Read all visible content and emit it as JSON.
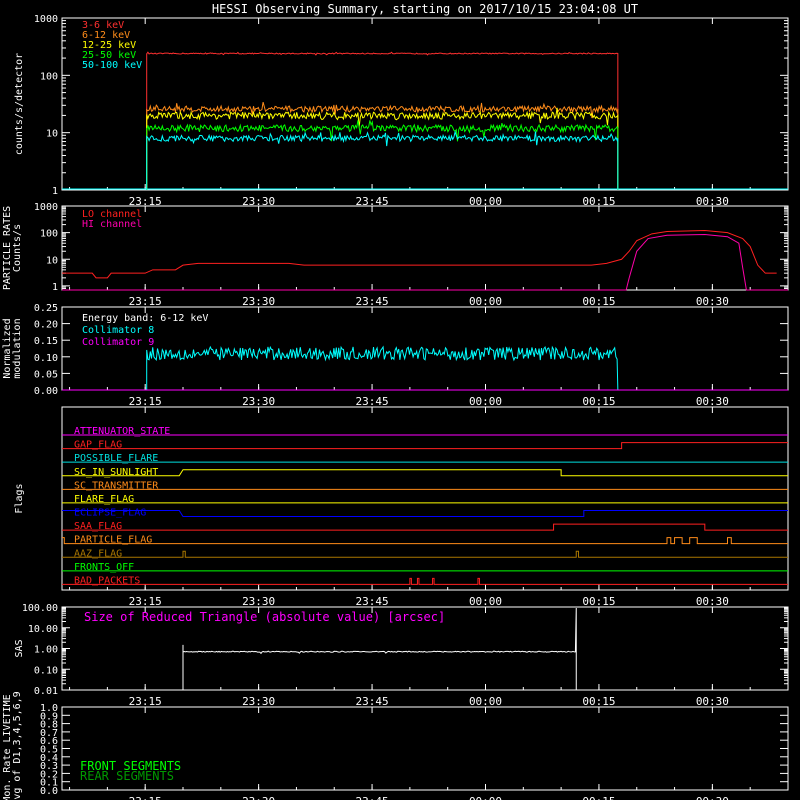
{
  "page": {
    "title": "HESSI Observing Summary, starting on 2017/10/15 23:04:08 UT"
  },
  "time_axis": {
    "tick_labels": [
      "23:15",
      "23:30",
      "23:45",
      "00:00",
      "00:15",
      "00:30"
    ],
    "tick_minutes": [
      11,
      26,
      41,
      56,
      71,
      86
    ],
    "minute_labels": [
      "23:15",
      "23:30",
      "23:45",
      "00:00",
      "00:15",
      "00:30"
    ],
    "range_minutes": [
      0,
      96
    ]
  },
  "chart_data": [
    {
      "name": "count-rates",
      "type": "line",
      "ylabel": "counts/s/detector",
      "yscale": "log",
      "ylim": [
        1,
        1000
      ],
      "yticks": [
        {
          "v": 1,
          "label": "1"
        },
        {
          "v": 10,
          "label": "10"
        },
        {
          "v": 100,
          "label": "100"
        },
        {
          "v": 1000,
          "label": "1000"
        }
      ],
      "legend_position": "top-left",
      "series": [
        {
          "name": "3-6 keV",
          "color": "#ff3030",
          "segments": [
            {
              "start": 11.2,
              "end": 73.5,
              "level": 240,
              "noise": 0.02
            }
          ]
        },
        {
          "name": "6-12 keV",
          "color": "#ff8c1a",
          "segments": [
            {
              "start": 11.2,
              "end": 73.5,
              "level": 26,
              "noise": 0.12
            }
          ]
        },
        {
          "name": "12-25 keV",
          "color": "#ffff00",
          "segments": [
            {
              "start": 11.2,
              "end": 73.5,
              "level": 20,
              "noise": 0.14
            }
          ]
        },
        {
          "name": "25-50 keV",
          "color": "#00ff00",
          "segments": [
            {
              "start": 11.2,
              "end": 73.5,
              "level": 12,
              "noise": 0.14
            }
          ]
        },
        {
          "name": "50-100 keV",
          "color": "#00ffff",
          "segments": [
            {
              "start": 11.2,
              "end": 73.5,
              "level": 8,
              "noise": 0.12
            }
          ]
        }
      ]
    },
    {
      "name": "particle-rates",
      "type": "line",
      "ylabel": [
        "PARTICLE RATES",
        "Counts/s"
      ],
      "yscale": "log",
      "ylim": [
        0.7,
        1000
      ],
      "yticks": [
        {
          "v": 1,
          "label": "1"
        },
        {
          "v": 10,
          "label": "10"
        },
        {
          "v": 100,
          "label": "100"
        },
        {
          "v": 1000,
          "label": "1000"
        }
      ],
      "legend_position": "top-left",
      "series": [
        {
          "name": "LO channel",
          "color": "#ff2020",
          "points": [
            [
              0,
              3
            ],
            [
              4,
              3
            ],
            [
              4.5,
              2
            ],
            [
              6,
              2
            ],
            [
              6.5,
              3
            ],
            [
              11,
              3
            ],
            [
              12,
              4
            ],
            [
              15,
              4
            ],
            [
              16,
              6
            ],
            [
              18,
              7
            ],
            [
              30,
              7
            ],
            [
              32,
              6
            ],
            [
              50,
              6
            ],
            [
              60,
              6
            ],
            [
              70,
              6
            ],
            [
              72,
              7
            ],
            [
              74,
              10
            ],
            [
              75,
              20
            ],
            [
              76,
              50
            ],
            [
              78,
              90
            ],
            [
              80,
              110
            ],
            [
              85,
              120
            ],
            [
              88,
              100
            ],
            [
              90,
              60
            ],
            [
              91,
              30
            ],
            [
              92,
              6
            ],
            [
              93,
              3
            ],
            [
              94.5,
              3
            ]
          ]
        },
        {
          "name": "HI channel",
          "color": "#ff00aa",
          "points": [
            [
              0,
              0.7
            ],
            [
              73.5,
              0.7
            ],
            [
              74.6,
              0.7
            ],
            [
              75,
              2
            ],
            [
              76,
              20
            ],
            [
              77.5,
              60
            ],
            [
              80,
              80
            ],
            [
              85,
              85
            ],
            [
              88,
              70
            ],
            [
              89.5,
              40
            ],
            [
              90,
              5
            ],
            [
              90.5,
              0.7
            ],
            [
              96,
              0.7
            ]
          ]
        }
      ]
    },
    {
      "name": "modulation",
      "type": "line",
      "ylabel": [
        "Normalized",
        "modulation"
      ],
      "ylim": [
        0,
        0.25
      ],
      "yticks": [
        {
          "v": 0,
          "label": "0.00"
        },
        {
          "v": 0.05,
          "label": "0.05"
        },
        {
          "v": 0.1,
          "label": "0.10"
        },
        {
          "v": 0.15,
          "label": "0.15"
        },
        {
          "v": 0.2,
          "label": "0.20"
        },
        {
          "v": 0.25,
          "label": "0.25"
        }
      ],
      "annotation": "Energy band: 6-12 keV",
      "legend_position": "top-left",
      "series": [
        {
          "name": "Collimator 8",
          "color": "#00ffff",
          "segments": [
            {
              "start": 11.2,
              "end": 73.5,
              "level": 0.11,
              "noise": 0.02
            }
          ]
        },
        {
          "name": "Collimator 9",
          "color": "#ff00ff",
          "points": [
            [
              0,
              0
            ],
            [
              96,
              0
            ]
          ]
        }
      ]
    },
    {
      "name": "flags",
      "type": "line",
      "ylabel": "Flags",
      "series": [
        {
          "name": "ATTENUATOR_STATE",
          "color": "#ff00ff",
          "points": [
            [
              0,
              0
            ],
            [
              96,
              0
            ]
          ]
        },
        {
          "name": "GAP_FLAG",
          "color": "#ff2020",
          "points": [
            [
              0,
              0
            ],
            [
              74,
              0
            ],
            [
              74,
              1
            ],
            [
              96,
              1
            ]
          ]
        },
        {
          "name": "POSSIBLE_FLARE",
          "color": "#00e0e0",
          "points": [
            [
              0,
              0
            ],
            [
              96,
              0
            ]
          ]
        },
        {
          "name": "SC_IN_SUNLIGHT",
          "color": "#ffff00",
          "points": [
            [
              0,
              0
            ],
            [
              15.5,
              0
            ],
            [
              16,
              1
            ],
            [
              66,
              1
            ],
            [
              66,
              0
            ],
            [
              96,
              0
            ]
          ]
        },
        {
          "name": "SC_TRANSMITTER",
          "color": "#ff8c1a",
          "points": [
            [
              0,
              0
            ],
            [
              96,
              0
            ]
          ]
        },
        {
          "name": "FLARE_FLAG",
          "color": "#ffff00",
          "points": [
            [
              0,
              0
            ],
            [
              96,
              0
            ]
          ]
        },
        {
          "name": "ECLIPSE_FLAG",
          "color": "#0000ff",
          "points": [
            [
              0,
              1
            ],
            [
              15.5,
              1
            ],
            [
              16,
              0
            ],
            [
              69,
              0
            ],
            [
              69,
              1
            ],
            [
              96,
              1
            ]
          ]
        },
        {
          "name": "SAA_FLAG",
          "color": "#ff2020",
          "points": [
            [
              0,
              0
            ],
            [
              65,
              0
            ],
            [
              65,
              1
            ],
            [
              85,
              1
            ],
            [
              85,
              0
            ],
            [
              96,
              0
            ]
          ]
        },
        {
          "name": "PARTICLE_FLAG",
          "color": "#ff8c1a",
          "points": [
            [
              0,
              1
            ],
            [
              0.3,
              1
            ],
            [
              0.3,
              0
            ],
            [
              80,
              0
            ],
            [
              80,
              1
            ],
            [
              80.5,
              1
            ],
            [
              80.5,
              0
            ],
            [
              81,
              0
            ],
            [
              81,
              1
            ],
            [
              82,
              1
            ],
            [
              82,
              0
            ],
            [
              83,
              0
            ],
            [
              83,
              1
            ],
            [
              84,
              1
            ],
            [
              84,
              0
            ],
            [
              88,
              0
            ],
            [
              88,
              1
            ],
            [
              88.5,
              1
            ],
            [
              88.5,
              0
            ],
            [
              96,
              0
            ]
          ]
        },
        {
          "name": "AAZ_FLAG",
          "color": "#aa7700",
          "points": [
            [
              0,
              0
            ],
            [
              16,
              0
            ],
            [
              16,
              1
            ],
            [
              16.3,
              1
            ],
            [
              16.3,
              0
            ],
            [
              68,
              0
            ],
            [
              68,
              1
            ],
            [
              68.3,
              1
            ],
            [
              68.3,
              0
            ],
            [
              96,
              0
            ]
          ]
        },
        {
          "name": "FRONTS_OFF",
          "color": "#00ff00",
          "points": [
            [
              0,
              0
            ],
            [
              96,
              0
            ]
          ]
        },
        {
          "name": "BAD_PACKETS",
          "color": "#ff2020",
          "points": [
            [
              0,
              0
            ],
            [
              46,
              0
            ],
            [
              46,
              1
            ],
            [
              46.2,
              1
            ],
            [
              46.2,
              0
            ],
            [
              47,
              0
            ],
            [
              47,
              1
            ],
            [
              47.2,
              1
            ],
            [
              47.2,
              0
            ],
            [
              49,
              0
            ],
            [
              49,
              1
            ],
            [
              49.2,
              1
            ],
            [
              49.2,
              0
            ],
            [
              55,
              0
            ],
            [
              55,
              1
            ],
            [
              55.2,
              1
            ],
            [
              55.2,
              0
            ],
            [
              96,
              0
            ]
          ]
        }
      ]
    },
    {
      "name": "sas",
      "type": "line",
      "ylabel": "SAS",
      "yscale": "log",
      "ylim": [
        0.01,
        100
      ],
      "yticks": [
        {
          "v": 0.01,
          "label": "0.01"
        },
        {
          "v": 0.1,
          "label": "0.10"
        },
        {
          "v": 1,
          "label": "1.00"
        },
        {
          "v": 10,
          "label": "10.00"
        },
        {
          "v": 100,
          "label": "100.00"
        }
      ],
      "annotation": "Size of Reduced Triangle (absolute value) [arcsec]",
      "series": [
        {
          "name": "SAS triangle",
          "color": "#ffffff",
          "segments": [
            {
              "start": 16,
              "end": 68,
              "level": 0.7,
              "noise": 0.05
            }
          ]
        }
      ]
    },
    {
      "name": "livetime",
      "type": "line",
      "ylabel": [
        "Mon. Rate LIVETIME",
        "avg of D1,3,4,5,6,9"
      ],
      "ylim": [
        0,
        1
      ],
      "yticks": [
        {
          "v": 0,
          "label": "0.0"
        },
        {
          "v": 0.1,
          "label": "0.1"
        },
        {
          "v": 0.2,
          "label": "0.2"
        },
        {
          "v": 0.3,
          "label": "0.3"
        },
        {
          "v": 0.4,
          "label": "0.4"
        },
        {
          "v": 0.5,
          "label": "0.5"
        },
        {
          "v": 0.6,
          "label": "0.6"
        },
        {
          "v": 0.7,
          "label": "0.7"
        },
        {
          "v": 0.8,
          "label": "0.8"
        },
        {
          "v": 0.9,
          "label": "0.9"
        },
        {
          "v": 1,
          "label": "1.0"
        }
      ],
      "legend_position": "bottom-left",
      "series": [
        {
          "name": "FRONT SEGMENTS",
          "color": "#00ff00",
          "points": []
        },
        {
          "name": "REAR SEGMENTS",
          "color": "#009900",
          "points": []
        }
      ]
    }
  ]
}
